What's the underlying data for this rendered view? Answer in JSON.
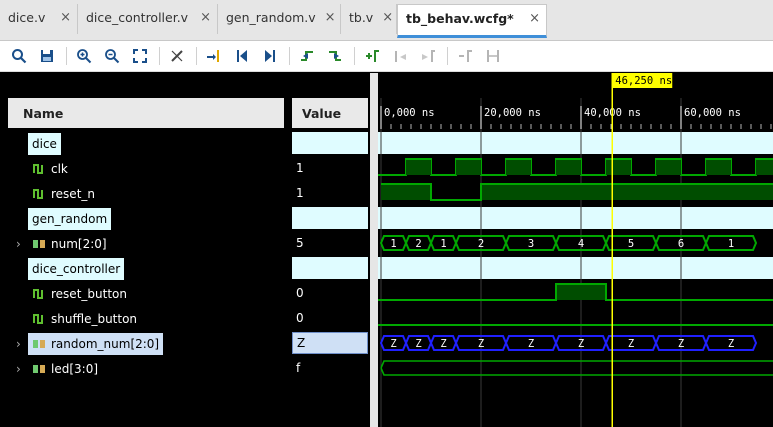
{
  "tabs": [
    {
      "label": "dice.v",
      "active": false
    },
    {
      "label": "dice_controller.v",
      "active": false
    },
    {
      "label": "gen_random.v",
      "active": false
    },
    {
      "label": "tb.v",
      "active": false
    },
    {
      "label": "tb_behav.wcfg*",
      "active": true
    }
  ],
  "close_glyph": "×",
  "toolbar": {
    "buttons": [
      "search-icon",
      "save-icon",
      "zoom-in-icon",
      "zoom-out-icon",
      "zoom-fit-icon",
      "cursor-icon",
      "goto-cursor-icon",
      "goto-start-icon",
      "goto-end-icon",
      "prev-transition-icon",
      "next-transition-icon",
      "add-marker-icon",
      "prev-marker-icon",
      "next-marker-icon",
      "delete-marker-icon",
      "swap-cursors-icon"
    ]
  },
  "columns": {
    "name": "Name",
    "value": "Value"
  },
  "signals": [
    {
      "name": "dice",
      "kind": "group",
      "value": ""
    },
    {
      "name": "clk",
      "kind": "bit",
      "value": "1"
    },
    {
      "name": "reset_n",
      "kind": "bit",
      "value": "1"
    },
    {
      "name": "gen_random",
      "kind": "group",
      "value": ""
    },
    {
      "name": "num[2:0]",
      "kind": "bus",
      "value": "5"
    },
    {
      "name": "dice_controller",
      "kind": "group",
      "value": ""
    },
    {
      "name": "reset_button",
      "kind": "bit",
      "value": "0"
    },
    {
      "name": "shuffle_button",
      "kind": "bit",
      "value": "0"
    },
    {
      "name": "random_num[2:0]",
      "kind": "bus",
      "value": "Z"
    },
    {
      "name": "led[3:0]",
      "kind": "bus",
      "value": "f"
    }
  ],
  "timeline": {
    "cursor_label": "46,250 ns",
    "cursor_time_ns": 46250,
    "ticks": [
      "0,000 ns",
      "20,000 ns",
      "40,000 ns",
      "60,000 ns"
    ],
    "tick_times_ns": [
      0,
      20000,
      40000,
      60000
    ]
  },
  "waves": {
    "num_values": [
      "1",
      "2",
      "1",
      "2",
      "3",
      "4",
      "5",
      "6",
      "1"
    ],
    "random_num_values": [
      "Z",
      "Z",
      "Z",
      "Z",
      "Z",
      "Z",
      "Z",
      "Z",
      "Z"
    ]
  },
  "colors": {
    "group_bg": "#dffcff",
    "wave_green": "#00a800",
    "wave_blue": "#2020ff",
    "cursor": "#ffff00"
  }
}
